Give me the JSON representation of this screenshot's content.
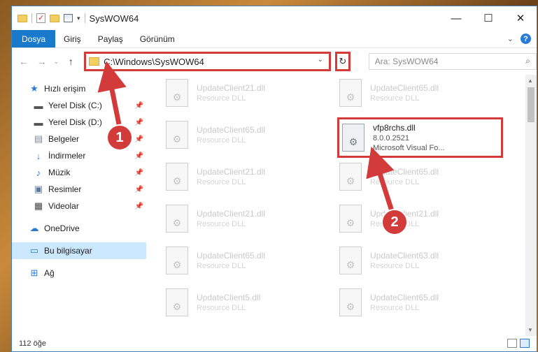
{
  "window": {
    "title": "SysWOW64"
  },
  "window_controls": {
    "minimize": "—",
    "maximize": "☐",
    "close": "✕"
  },
  "ribbon": {
    "tabs": [
      {
        "label": "Dosya"
      },
      {
        "label": "Giriş"
      },
      {
        "label": "Paylaş"
      },
      {
        "label": "Görünüm"
      }
    ],
    "help": "?"
  },
  "nav": {
    "address": "C:\\Windows\\SysWOW64",
    "search_placeholder": "Ara: SysWOW64"
  },
  "sidebar": {
    "items": [
      {
        "label": "Hızlı erişim",
        "icon": "star-icon"
      },
      {
        "label": "Yerel Disk (C:)",
        "icon": "drive-icon"
      },
      {
        "label": "Yerel Disk (D:)",
        "icon": "drive-icon"
      },
      {
        "label": "Belgeler",
        "icon": "documents-icon"
      },
      {
        "label": "İndirmeler",
        "icon": "download-icon"
      },
      {
        "label": "Müzik",
        "icon": "music-icon"
      },
      {
        "label": "Resimler",
        "icon": "pictures-icon"
      },
      {
        "label": "Videolar",
        "icon": "videos-icon"
      },
      {
        "label": "OneDrive",
        "icon": "cloud-icon"
      },
      {
        "label": "Bu bilgisayar",
        "icon": "computer-icon"
      },
      {
        "label": "Ağ",
        "icon": "network-icon"
      }
    ]
  },
  "files": [
    {
      "name": "UpdateClient21.dll",
      "type": "Resource DLL"
    },
    {
      "name": "UpdateClient65.dll",
      "type": "Resource DLL"
    },
    {
      "name": "UpdateClient65.dll",
      "type": "Resource DLL"
    },
    {
      "name": "vfp8rchs.dll",
      "version": "8.0.0.2521",
      "desc": "Microsoft Visual Fo..."
    },
    {
      "name": "UpdateClient21.dll",
      "type": "Resource DLL"
    },
    {
      "name": "UpdateClient65.dll",
      "type": "Resource DLL"
    },
    {
      "name": "UpdateClient21.dll",
      "type": "Resource DLL"
    },
    {
      "name": "UpdateClient21.dll",
      "type": "Resource DLL"
    },
    {
      "name": "UpdateClient65.dll",
      "type": "Resource DLL"
    },
    {
      "name": "UpdateClient63.dll",
      "type": "Resource DLL"
    },
    {
      "name": "UpdateClient5.dll",
      "type": "Resource DLL"
    },
    {
      "name": "UpdateClient65.dll",
      "type": "Resource DLL"
    }
  ],
  "status": {
    "count": "112 öğe"
  },
  "annotations": {
    "step1": "1",
    "step2": "2"
  },
  "colors": {
    "accent": "#1979ca",
    "highlight": "#d33a3a",
    "selection": "#cce8ff"
  }
}
